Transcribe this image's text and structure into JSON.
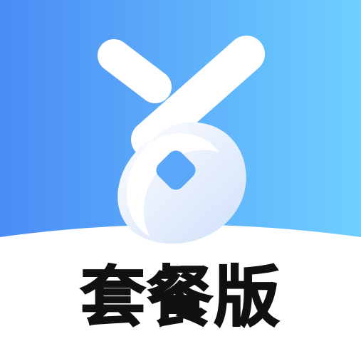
{
  "caption": "套餐版",
  "colors": {
    "gradient_start": "#4a8cf5",
    "gradient_end": "#6fd0ff",
    "logo_white": "#ffffff",
    "logo_shade": "#d7e6fb",
    "caption_text": "#111111",
    "background": "#ffffff"
  },
  "icons": {
    "logo": "stylized-x-loop-logo"
  }
}
